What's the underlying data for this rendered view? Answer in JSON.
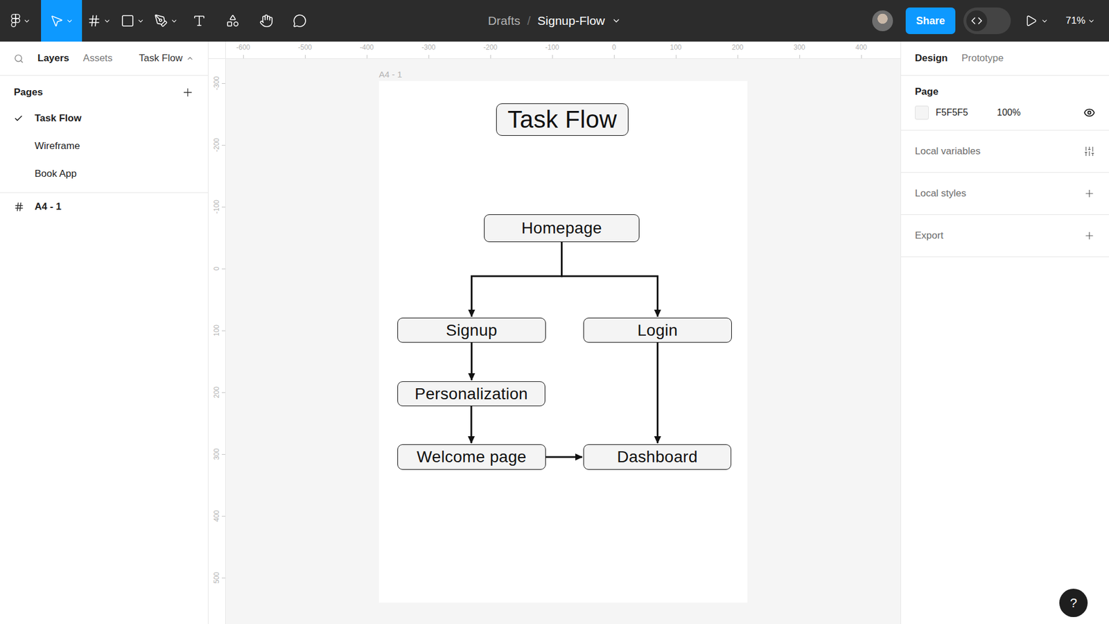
{
  "toolbar": {
    "tools": [
      {
        "kind": "move",
        "selected": true,
        "dropdown": true
      },
      {
        "kind": "frame",
        "selected": false,
        "dropdown": true
      },
      {
        "kind": "shape",
        "selected": false,
        "dropdown": true
      },
      {
        "kind": "pen",
        "selected": false,
        "dropdown": true
      },
      {
        "kind": "text",
        "selected": false,
        "dropdown": false
      },
      {
        "kind": "resources",
        "selected": false,
        "dropdown": false
      },
      {
        "kind": "hand",
        "selected": false,
        "dropdown": false
      },
      {
        "kind": "comment",
        "selected": false,
        "dropdown": false
      }
    ],
    "breadcrumb": {
      "folder": "Drafts",
      "separator": "/",
      "file": "Signup-Flow"
    },
    "share": "Share",
    "dev_mode": false,
    "zoom": "71%"
  },
  "left_panel": {
    "tabs": [
      {
        "label": "Layers",
        "selected": true
      },
      {
        "label": "Assets",
        "selected": false
      }
    ],
    "page_selector": "Task Flow",
    "pages_title": "Pages",
    "pages": [
      {
        "label": "Task Flow",
        "selected": true
      },
      {
        "label": "Wireframe",
        "selected": false
      },
      {
        "label": "Book App",
        "selected": false
      }
    ],
    "layers": [
      {
        "label": "A4 - 1"
      }
    ]
  },
  "canvas": {
    "ruler_x": [
      "-600",
      "-500",
      "-400",
      "-300",
      "-200",
      "-100",
      "0",
      "100",
      "200",
      "300",
      "400"
    ],
    "ruler_y": [
      "-300",
      "-200",
      "-100",
      "0",
      "100",
      "200",
      "300",
      "400",
      "500"
    ],
    "frame": {
      "label": "A4 - 1"
    },
    "nodes": [
      {
        "label": "Task Flow",
        "kind": "title"
      },
      {
        "label": "Homepage",
        "kind": "step"
      },
      {
        "label": "Signup",
        "kind": "step"
      },
      {
        "label": "Login",
        "kind": "step"
      },
      {
        "label": "Personalization",
        "kind": "step"
      },
      {
        "label": "Welcome page",
        "kind": "step"
      },
      {
        "label": "Dashboard",
        "kind": "step"
      }
    ],
    "edges": [
      {
        "from": "Homepage",
        "to": "Signup"
      },
      {
        "from": "Homepage",
        "to": "Login"
      },
      {
        "from": "Signup",
        "to": "Personalization"
      },
      {
        "from": "Personalization",
        "to": "Welcome page"
      },
      {
        "from": "Login",
        "to": "Dashboard"
      },
      {
        "from": "Welcome page",
        "to": "Dashboard"
      }
    ]
  },
  "right_panel": {
    "tabs": [
      {
        "label": "Design",
        "selected": true
      },
      {
        "label": "Prototype",
        "selected": false
      }
    ],
    "page_section": {
      "title": "Page",
      "color": "F5F5F5",
      "opacity": "100%",
      "visible": true
    },
    "sections": [
      {
        "label": "Local variables",
        "kind": "variables"
      },
      {
        "label": "Local styles",
        "kind": "add"
      },
      {
        "label": "Export",
        "kind": "add"
      }
    ]
  },
  "help": "?"
}
